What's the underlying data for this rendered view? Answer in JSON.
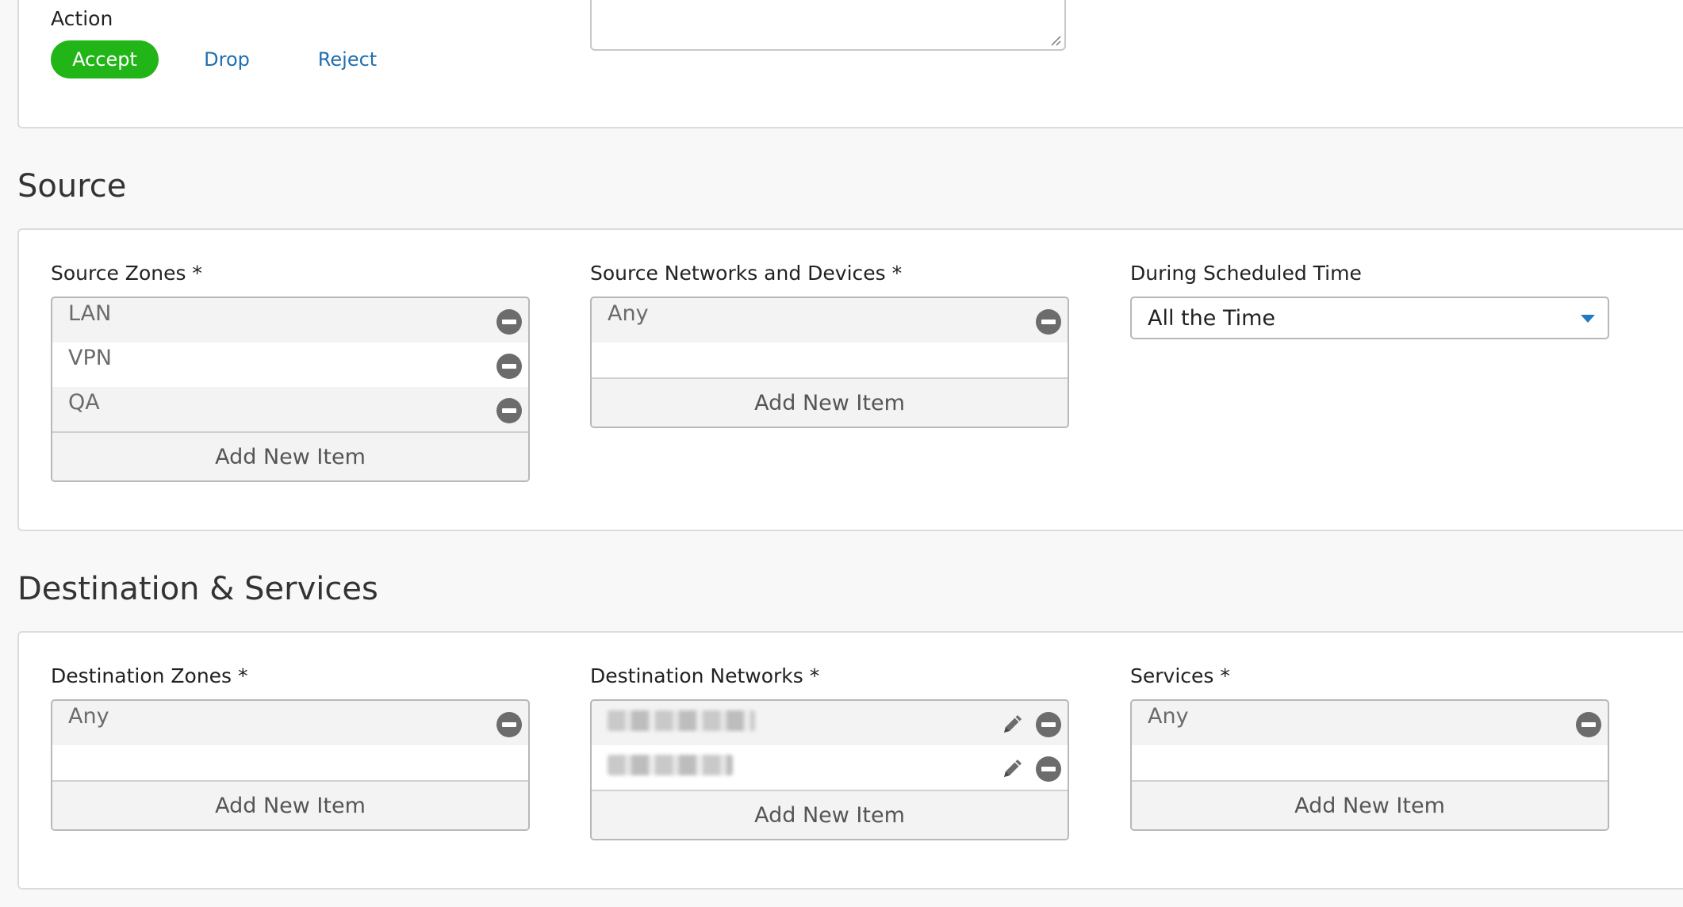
{
  "action": {
    "label": "Action",
    "options": [
      {
        "label": "Accept",
        "active": true
      },
      {
        "label": "Drop",
        "active": false
      },
      {
        "label": "Reject",
        "active": false
      }
    ]
  },
  "source": {
    "heading": "Source",
    "zones": {
      "label": "Source Zones *",
      "items": [
        "LAN",
        "VPN",
        "QA"
      ],
      "add_label": "Add New Item"
    },
    "networks": {
      "label": "Source Networks and Devices *",
      "items": [
        "Any"
      ],
      "add_label": "Add New Item"
    },
    "schedule": {
      "label": "During Scheduled Time",
      "value": "All the Time"
    }
  },
  "destination": {
    "heading": "Destination & Services",
    "zones": {
      "label": "Destination Zones *",
      "items": [
        "Any"
      ],
      "add_label": "Add New Item"
    },
    "networks": {
      "label": "Destination Networks *",
      "add_label": "Add New Item"
    },
    "services": {
      "label": "Services *",
      "items": [
        "Any"
      ],
      "add_label": "Add New Item"
    }
  },
  "colors": {
    "accept_green": "#22b518",
    "link_blue": "#1f6fb0",
    "icon_gray": "#6c6c6c"
  }
}
